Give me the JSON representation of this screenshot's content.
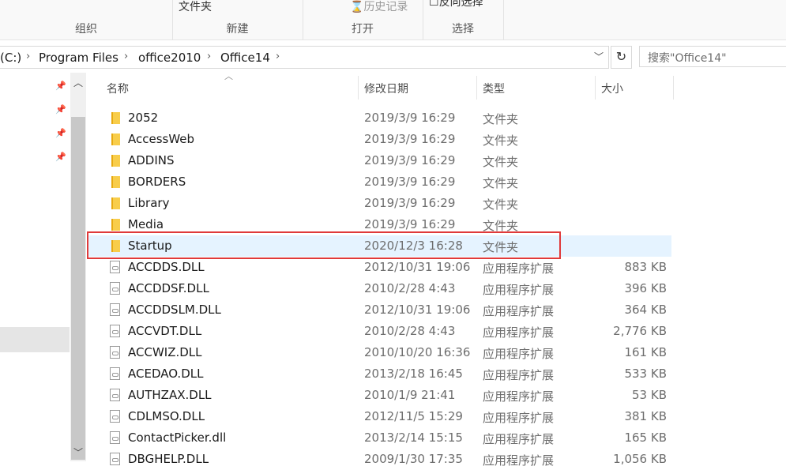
{
  "ribbon": {
    "groups": [
      "组织",
      "新建",
      "打开",
      "选择"
    ],
    "new_folder_label": "文件夹",
    "history_label": "历史记录",
    "select_label": "反向选择"
  },
  "address": {
    "crumbs": [
      "(C:)",
      "Program Files",
      "office2010",
      "Office14"
    ],
    "search_placeholder": "搜索\"Office14\""
  },
  "columns": {
    "name": "名称",
    "date": "修改日期",
    "type": "类型",
    "size": "大小"
  },
  "files": [
    {
      "name": "2052",
      "date": "2019/3/9 16:29",
      "type": "文件夹",
      "size": "",
      "kind": "folder-icon"
    },
    {
      "name": "AccessWeb",
      "date": "2019/3/9 16:29",
      "type": "文件夹",
      "size": "",
      "kind": "folder-icon"
    },
    {
      "name": "ADDINS",
      "date": "2019/3/9 16:29",
      "type": "文件夹",
      "size": "",
      "kind": "folder-icon"
    },
    {
      "name": "BORDERS",
      "date": "2019/3/9 16:29",
      "type": "文件夹",
      "size": "",
      "kind": "folder-icon"
    },
    {
      "name": "Library",
      "date": "2019/3/9 16:29",
      "type": "文件夹",
      "size": "",
      "kind": "folder-icon"
    },
    {
      "name": "Media",
      "date": "2019/3/9 16:29",
      "type": "文件夹",
      "size": "",
      "kind": "folder-icon"
    },
    {
      "name": "Startup",
      "date": "2020/12/3 16:28",
      "type": "文件夹",
      "size": "",
      "kind": "folder-icon",
      "selected": true
    },
    {
      "name": "ACCDDS.DLL",
      "date": "2012/10/31 19:06",
      "type": "应用程序扩展",
      "size": "883 KB",
      "kind": "dll-file-icon"
    },
    {
      "name": "ACCDDSF.DLL",
      "date": "2010/2/28 4:43",
      "type": "应用程序扩展",
      "size": "396 KB",
      "kind": "dll-file-icon"
    },
    {
      "name": "ACCDDSLM.DLL",
      "date": "2012/10/31 19:06",
      "type": "应用程序扩展",
      "size": "364 KB",
      "kind": "dll-file-icon"
    },
    {
      "name": "ACCVDT.DLL",
      "date": "2010/2/28 4:43",
      "type": "应用程序扩展",
      "size": "2,776 KB",
      "kind": "dll-file-icon"
    },
    {
      "name": "ACCWIZ.DLL",
      "date": "2010/10/20 16:36",
      "type": "应用程序扩展",
      "size": "161 KB",
      "kind": "dll-file-icon"
    },
    {
      "name": "ACEDAO.DLL",
      "date": "2013/2/18 16:45",
      "type": "应用程序扩展",
      "size": "533 KB",
      "kind": "dll-file-icon"
    },
    {
      "name": "AUTHZAX.DLL",
      "date": "2010/1/9 21:41",
      "type": "应用程序扩展",
      "size": "53 KB",
      "kind": "dll-file-icon"
    },
    {
      "name": "CDLMSO.DLL",
      "date": "2012/11/5 15:29",
      "type": "应用程序扩展",
      "size": "381 KB",
      "kind": "dll-file-icon"
    },
    {
      "name": "ContactPicker.dll",
      "date": "2013/2/14 15:15",
      "type": "应用程序扩展",
      "size": "165 KB",
      "kind": "dll-file-icon"
    },
    {
      "name": "DBGHELP.DLL",
      "date": "2009/1/30 17:35",
      "type": "应用程序扩展",
      "size": "1,056 KB",
      "kind": "dll-file-icon"
    }
  ],
  "colors": {
    "selection": "#e5f3ff",
    "highlight_border": "#e03a3a",
    "folder": "#f8cd4a"
  }
}
